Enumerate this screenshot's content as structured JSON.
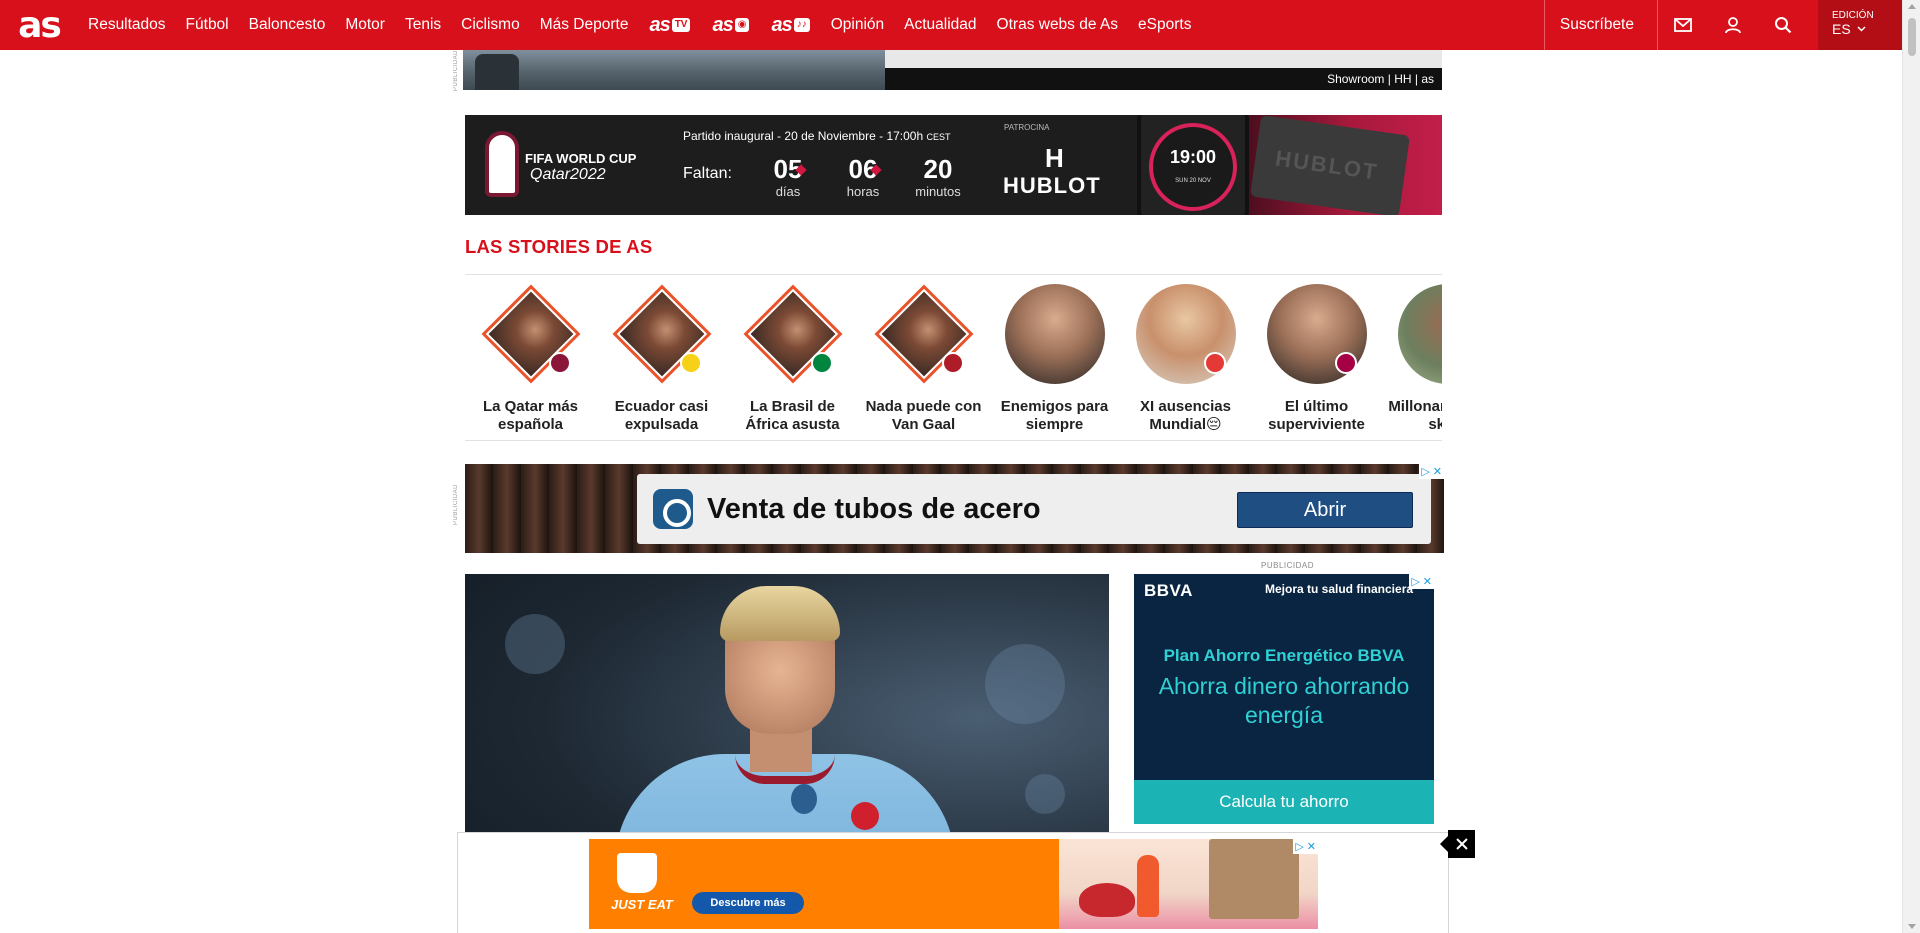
{
  "header": {
    "logo": "as",
    "nav": [
      "Resultados",
      "Fútbol",
      "Baloncesto",
      "Motor",
      "Tenis",
      "Ciclismo",
      "Más Deporte"
    ],
    "brands": [
      {
        "text": "as",
        "pill": "TV"
      },
      {
        "text": "as",
        "pill": "◉"
      },
      {
        "text": "as",
        "pill": "♪♪"
      }
    ],
    "nav2": [
      "Opinión",
      "Actualidad",
      "Otras webs de As",
      "eSports"
    ],
    "subscribe": "Suscríbete",
    "edition_label": "EDICIÓN",
    "edition_value": "ES",
    "icons": [
      "mail-icon",
      "user-icon",
      "search-icon"
    ]
  },
  "top_ad": {
    "side_label": "PUBLICIDAD",
    "strip_text": "Showroom  |  HH  |  as"
  },
  "worldcup": {
    "title": "FIFA WORLD CUP",
    "subtitle": "Qatar2022",
    "match": "Partido inaugural - 20 de Noviembre - 17:00h",
    "tz": "CEST",
    "faltan": "Faltan:",
    "countdown": [
      {
        "value": "05",
        "unit": "días"
      },
      {
        "value": "06",
        "unit": "horas"
      },
      {
        "value": "20",
        "unit": "minutos"
      }
    ],
    "sponsor_label": "PATROCINA",
    "sponsor_mark": "H",
    "sponsor": "HUBLOT",
    "watch_time": "19:00",
    "watch_date": "SUN 20 NOV",
    "strap_text": "HUBLOT"
  },
  "stories": {
    "title": "LAS STORIES DE AS",
    "items": [
      {
        "label": "La Qatar más española",
        "shape": "diamond",
        "flag": "#8a1538"
      },
      {
        "label": "Ecuador casi expulsada",
        "shape": "diamond",
        "flag": "#f7d117"
      },
      {
        "label": "La Brasil de África asusta",
        "shape": "diamond",
        "flag": "#00853f"
      },
      {
        "label": "Nada puede con Van Gaal",
        "shape": "diamond",
        "flag": "#ae1c28"
      },
      {
        "label": "Enemigos para siempre",
        "shape": "circle",
        "flag": ""
      },
      {
        "label": "XI ausencias Mundial😔",
        "shape": "circle",
        "flag": "#e53935"
      },
      {
        "label": "El último superviviente",
        "shape": "circle",
        "flag": "#a50044"
      },
      {
        "label": "Millonario con el skate",
        "shape": "circle",
        "flag": ""
      }
    ]
  },
  "mid_ad": {
    "side_label": "PUBLICIDAD",
    "text": "Venta de tubos de acero",
    "button": "Abrir"
  },
  "right_ad": {
    "label": "PUBLICIDAD",
    "logo": "BBVA",
    "header": "Mejora tu salud financiera",
    "line1": "Plan Ahorro Energético BBVA",
    "line2": "Ahorra dinero ahorrando energía",
    "button": "Calcula tu ahorro"
  },
  "sticky_ad": {
    "brand": "JUST EAT",
    "button": "Descubre más"
  }
}
